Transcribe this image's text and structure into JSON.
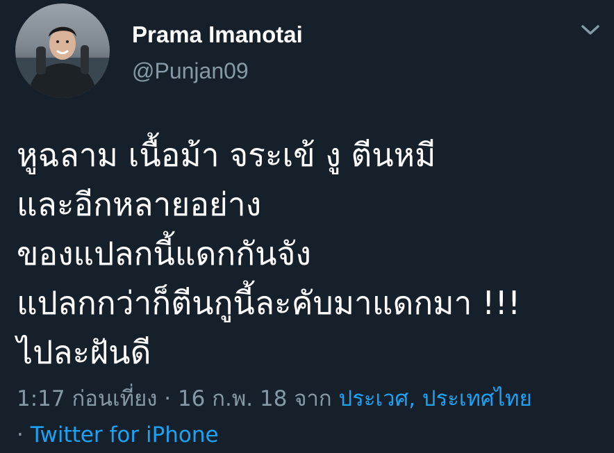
{
  "user": {
    "display_name": "Prama Imanotai",
    "handle": "@Punjan09"
  },
  "tweet": {
    "lines": [
      "หูฉลาม เนื้อม้า จระเข้ งู ตีนหมี",
      "และอีกหลายอย่าง",
      "ของแปลกนี้แดกกันจัง",
      "แปลกกว่าก็ตีนกูนี้ละคับมาแดกมา !!!",
      "ไปละฝันดี"
    ]
  },
  "meta": {
    "time": "1:17 ก่อนเที่ยง",
    "separator": " · ",
    "date": "16 ก.พ. 18",
    "from_label": " จาก ",
    "location": "ประเวศ, ประเทศไทย",
    "source_separator": "· ",
    "source": "Twitter for iPhone"
  },
  "icons": {
    "caret": "chevron-down-icon"
  },
  "colors": {
    "background": "#15202b",
    "primary_text": "#ffffff",
    "secondary_text": "#8899a6",
    "link": "#1da1f2"
  }
}
